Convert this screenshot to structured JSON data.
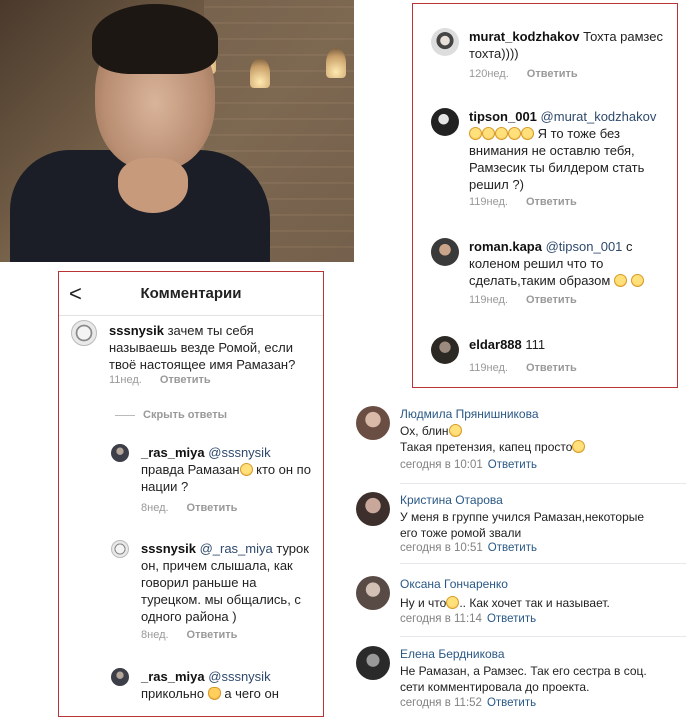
{
  "instagram_left": {
    "header_title": "Комментарии",
    "back_glyph": "<",
    "comments": [
      {
        "username": "sssnysik",
        "text": "зачем ты себя называешь везде Ромой, если твоё настоящее имя Рамазан?",
        "time": "11нед.",
        "reply": "Ответить"
      },
      {
        "username": "_ras_miya",
        "mention": "@sssnysik",
        "text_before_emoji": "правда Рамазан",
        "text_after_emoji": " кто он по нации ?",
        "emoji": "smiling-face",
        "time": "8нед.",
        "reply": "Ответить"
      },
      {
        "username": "sssnysik",
        "mention": "@_ras_miya",
        "text": " турок он, причем слышала, как говорил раньше на турецком. мы общались, с одного района )",
        "time": "8нед.",
        "reply": "Ответить"
      },
      {
        "username": "_ras_miya",
        "mention": "@sssnysik",
        "text_before_emoji": "прикольно",
        "text_after_emoji": " а чего он",
        "emoji": "smiling-cat"
      }
    ],
    "hide_replies": "Скрыть ответы"
  },
  "instagram_right": {
    "comments": [
      {
        "username": "murat_kodzhakov",
        "text": "Тохта рамзес тохта))))",
        "time": "120нед.",
        "reply": "Ответить"
      },
      {
        "username": "tipson_001",
        "mention": "@murat_kodzhakov",
        "text": "Я то тоже без внимания не оставлю тебя, Рамзесик ты билдером стать решил ?)",
        "emoji": "laughing-face",
        "emoji_count": 5,
        "time": "119нед.",
        "reply": "Ответить"
      },
      {
        "username": "roman.kapa",
        "mention": "@tipson_001",
        "text": " с коленом решил что то сделать,таким образом",
        "emoji": "grinning-face",
        "emoji_count": 2,
        "time": "119нед.",
        "reply": "Ответить"
      },
      {
        "username": "eldar888",
        "text": "111",
        "time": "119нед.",
        "reply": "Ответить"
      }
    ]
  },
  "vk": {
    "comments": [
      {
        "name": "Людмила Прянишникова",
        "line1": "Ох, блин",
        "line2": "Такая претензия, капец просто",
        "time": "сегодня в 10:01",
        "reply": "Ответить"
      },
      {
        "name": "Кристина Отарова",
        "line1": "У меня в группе учился Рамазан,некоторые его тоже ромой звали",
        "time": "сегодня в 10:51",
        "reply": "Ответить"
      },
      {
        "name": "Оксана Гончаренко",
        "line1": "Ну и что",
        "line1_after": ".. Как хочет так и называет.",
        "time": "сегодня в 11:14",
        "reply": "Ответить"
      },
      {
        "name": "Елена Бердникова",
        "line1": "Не Рамазан, а Рамзес. Так его сестра в соц. сети комментировала до проекта.",
        "time": "сегодня в 11:52",
        "reply": "Ответить"
      }
    ]
  }
}
